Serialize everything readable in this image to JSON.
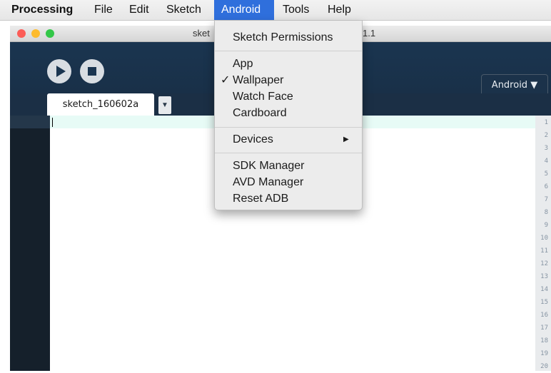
{
  "menubar": {
    "app": "Processing",
    "items": [
      "File",
      "Edit",
      "Sketch",
      "Android",
      "Tools",
      "Help"
    ],
    "active": "Android"
  },
  "window": {
    "title_left": "sket",
    "title_right": "1.1",
    "traffic_colors": [
      "#fc5c57",
      "#fdbb2e",
      "#33c748"
    ]
  },
  "toolbar": {
    "run_icon": "play-icon",
    "stop_icon": "stop-icon",
    "mode_label": "Android ▼"
  },
  "tabs": {
    "sketch_tab": "sketch_160602a",
    "tab_menu": "▼"
  },
  "editor": {
    "line_numbers": [
      "1",
      "2",
      "3",
      "4",
      "5",
      "6",
      "7",
      "8",
      "9",
      "10",
      "11",
      "12",
      "13",
      "14",
      "15",
      "16",
      "17",
      "18",
      "19",
      "20"
    ]
  },
  "android_menu": {
    "sketch_permissions": "Sketch Permissions",
    "app": "App",
    "wallpaper": "Wallpaper",
    "wallpaper_checked": "✓",
    "watch_face": "Watch Face",
    "cardboard": "Cardboard",
    "devices": "Devices",
    "devices_arrow": "▶",
    "sdk_manager": "SDK Manager",
    "avd_manager": "AVD Manager",
    "reset_adb": "Reset ADB"
  },
  "colors": {
    "menu_highlight": "#2f6fdc",
    "toolbar_bg": "#1a3550",
    "gutter_bg": "#15202b"
  }
}
